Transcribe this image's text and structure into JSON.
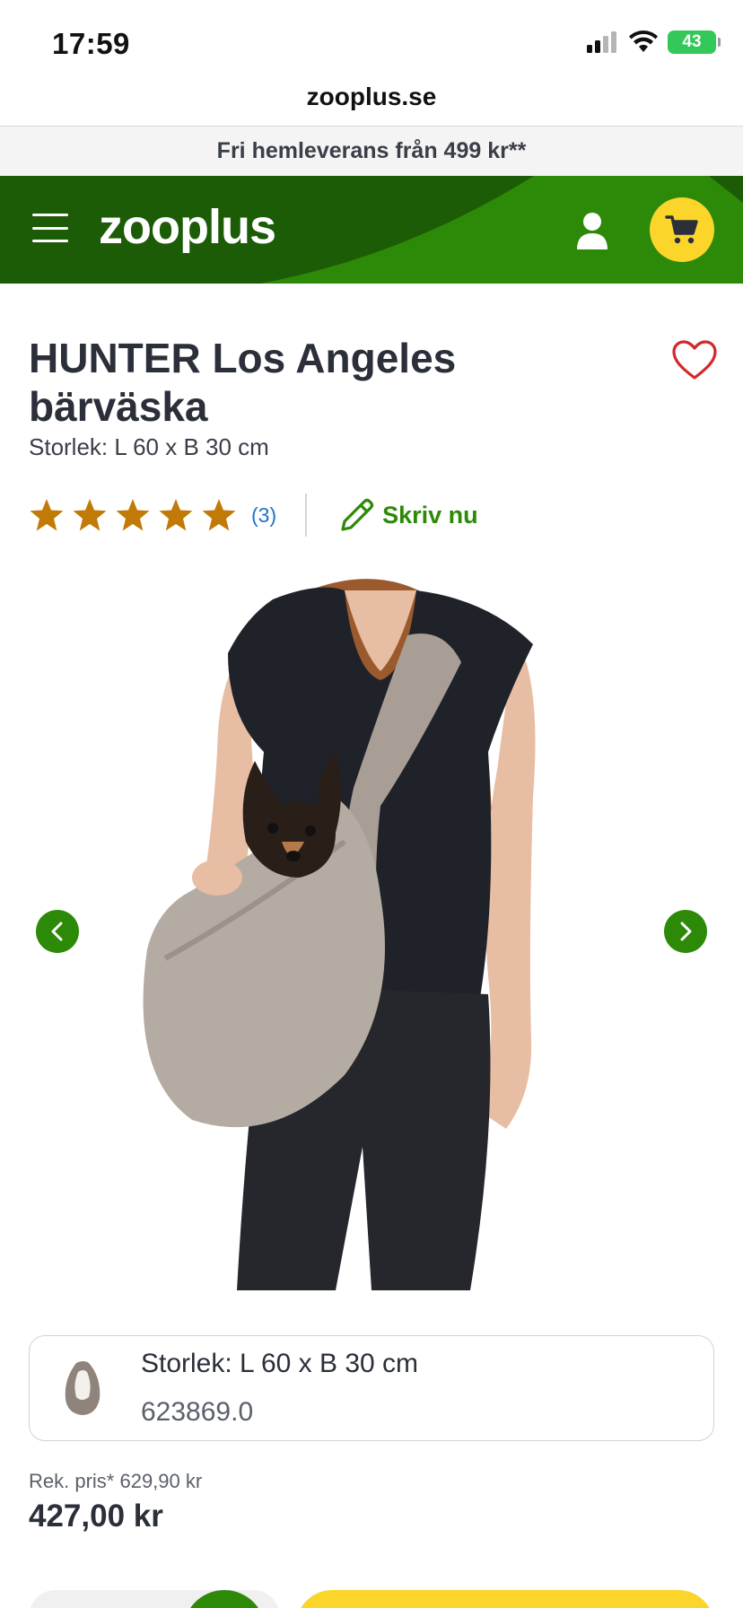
{
  "status_bar": {
    "time": "17:59",
    "battery": "43"
  },
  "browser": {
    "url": "zooplus.se"
  },
  "promo": {
    "text": "Fri hemleverans från 499 kr**"
  },
  "header": {
    "logo": "zooplus"
  },
  "product": {
    "title": "HUNTER Los Angeles bärväska",
    "subtitle": "Storlek: L 60 x B 30 cm",
    "rating": {
      "stars": 5,
      "count": "(3)"
    },
    "write_review": "Skriv nu"
  },
  "variant": {
    "name": "Storlek: L 60 x B 30 cm",
    "code": "623869.0"
  },
  "pricing": {
    "rek": "Rek. pris* 629,90 kr",
    "price": "427,00 kr"
  },
  "colors": {
    "brand_green": "#2c8a08",
    "dark_green": "#1a5a05",
    "cart_yellow": "#fbd52a",
    "star_orange": "#c27a06",
    "link_blue": "#1f73c7",
    "heart_red": "#d62828"
  },
  "icons": {
    "menu": "hamburger-icon",
    "account": "user-icon",
    "cart": "cart-icon",
    "favorite": "heart-icon",
    "review": "pencil-icon",
    "prev": "chevron-left-icon",
    "next": "chevron-right-icon"
  }
}
